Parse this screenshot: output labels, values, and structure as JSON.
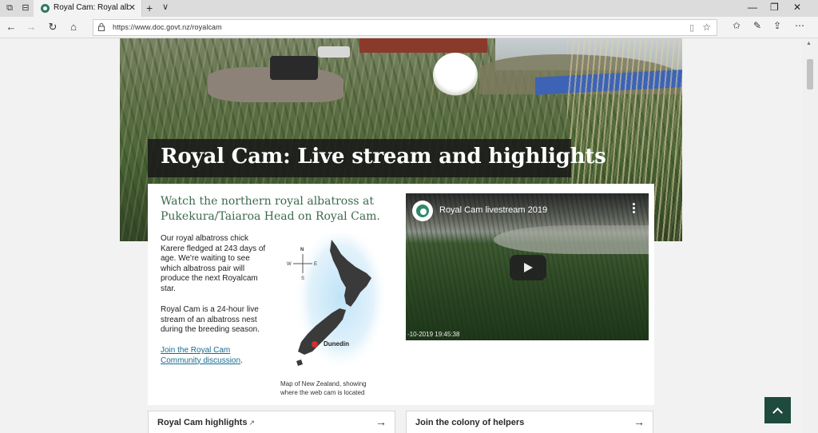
{
  "browser": {
    "tab_title": "Royal Cam: Royal albatr",
    "url": "https://www.doc.govt.nz/royalcam",
    "icons": [
      "tab-set-aside-icon",
      "back-icon",
      "forward-icon",
      "refresh-icon",
      "home-icon",
      "lock-icon",
      "reading-view-icon",
      "favorite-star-icon",
      "favorites-list-icon",
      "notes-pen-icon",
      "share-icon",
      "more-icon"
    ]
  },
  "page": {
    "title": "Royal Cam: Live stream and highlights",
    "intro": "Watch the northern royal albatross at Pukekura/Taiaroa Head on Royal Cam.",
    "para1": "Our royal albatross chick Karere fledged at 243 days of age. We're waiting to see which albatross pair will produce the next Royalcam star.",
    "para2": "Royal Cam is a 24-hour live stream of an albatross nest during the breeding season.",
    "link_text": "Join the Royal Cam Community discussion",
    "link_suffix": ".",
    "map_label": "Dunedin",
    "compass": {
      "n": "N",
      "s": "S",
      "e": "E",
      "w": "W"
    },
    "map_caption": "Map of New Zealand, showing where the web cam is located",
    "video_title": "Royal Cam livestream 2019",
    "video_timestamp": "-10-2019 19:45:38",
    "cards": [
      {
        "label": "Royal Cam highlights",
        "ext": "↗",
        "arrow": "→"
      },
      {
        "label": "Join the colony of helpers",
        "arrow": "→"
      }
    ],
    "colors": {
      "accent_green": "#3b6b4d",
      "dark_green": "#1f4a3e",
      "marker_red": "#d32f2f"
    }
  }
}
